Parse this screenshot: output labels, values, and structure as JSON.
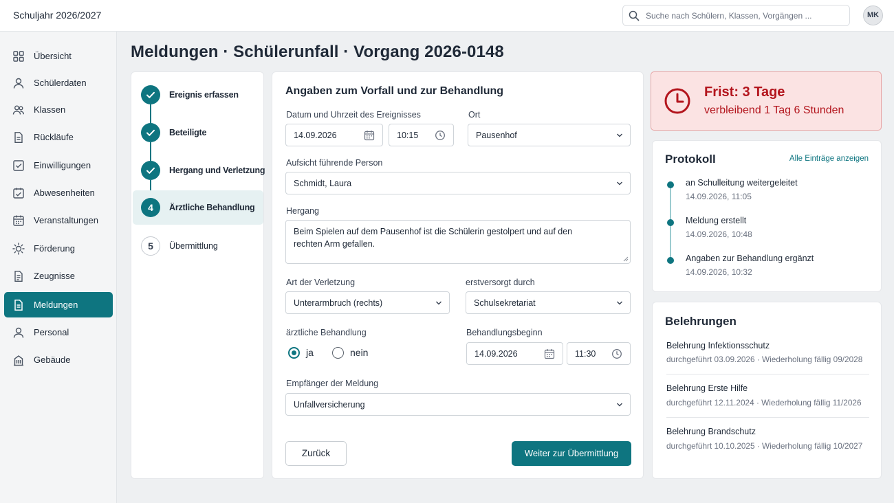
{
  "header": {
    "school_year": "Schuljahr 2026/2027",
    "search_placeholder": "Suche nach Schülern, Klassen, Vorgängen ...",
    "user_initials": "MK"
  },
  "sidebar": {
    "items": [
      {
        "label": "Übersicht",
        "icon": "grid-icon",
        "active": false
      },
      {
        "label": "Schülerdaten",
        "icon": "person-icon",
        "active": false
      },
      {
        "label": "Klassen",
        "icon": "group-icon",
        "active": false
      },
      {
        "label": "Rückläufe",
        "icon": "document-icon",
        "active": false
      },
      {
        "label": "Einwilligungen",
        "icon": "checkbox-icon",
        "active": false
      },
      {
        "label": "Abwesenheiten",
        "icon": "calendar-check-icon",
        "active": false
      },
      {
        "label": "Veranstaltungen",
        "icon": "calendar-icon",
        "active": false
      },
      {
        "label": "Förderung",
        "icon": "sun-icon",
        "active": false
      },
      {
        "label": "Zeugnisse",
        "icon": "certificate-icon",
        "active": false
      },
      {
        "label": "Meldungen",
        "icon": "report-icon",
        "active": true
      },
      {
        "label": "Personal",
        "icon": "person-icon",
        "active": false
      },
      {
        "label": "Gebäude",
        "icon": "building-icon",
        "active": false
      }
    ]
  },
  "page": {
    "title": "Meldungen · Schülerunfall · Vorgang 2026-0148"
  },
  "stepper": {
    "steps": [
      {
        "label": "Ereignis erfassen",
        "state": "done",
        "number": "1"
      },
      {
        "label": "Beteiligte",
        "state": "done",
        "number": "2"
      },
      {
        "label": "Hergang und Verletzung",
        "state": "done",
        "number": "3"
      },
      {
        "label": "Ärztliche Behandlung",
        "state": "current",
        "number": "4"
      },
      {
        "label": "Übermittlung",
        "state": "todo",
        "number": "5"
      }
    ]
  },
  "form": {
    "title": "Angaben zum Vorfall und zur Behandlung",
    "event_datetime_label": "Datum und Uhrzeit des Ereignisses",
    "event_date": "14.09.2026",
    "event_time": "10:15",
    "location_label": "Ort",
    "location": "Pausenhof",
    "supervisor_label": "Aufsicht führende Person",
    "supervisor": "Schmidt, Laura",
    "course_label": "Hergang",
    "course_text": "Beim Spielen auf dem Pausenhof ist die Schülerin gestolpert und auf den rechten Arm gefallen.",
    "injury_label": "Art der Verletzung",
    "injury": "Unterarmbruch (rechts)",
    "first_aid_label": "erstversorgt durch",
    "first_aid": "Schulsekretariat",
    "medical_label": "ärztliche Behandlung",
    "medical_yes": "ja",
    "medical_no": "nein",
    "medical_value": "ja",
    "treatment_start_label": "Behandlungsbeginn",
    "treatment_date": "14.09.2026",
    "treatment_time": "11:30",
    "recipient_label": "Empfänger der Meldung",
    "recipient": "Unfallversicherung",
    "back_label": "Zurück",
    "next_label": "Weiter zur Übermittlung"
  },
  "deadline": {
    "title": "Frist: 3 Tage",
    "remaining": "verbleibend 1 Tag 6 Stunden",
    "color": "#b3151d"
  },
  "protocol": {
    "title": "Protokoll",
    "show_all": "Alle Einträge anzeigen",
    "entries": [
      {
        "title": "an Schulleitung weitergeleitet",
        "time": "14.09.2026, 11:05"
      },
      {
        "title": "Meldung erstellt",
        "time": "14.09.2026, 10:48"
      },
      {
        "title": "Angaben zur Behandlung ergänzt",
        "time": "14.09.2026, 10:32"
      }
    ]
  },
  "instructions": {
    "title": "Belehrungen",
    "items": [
      {
        "title": "Belehrung Infektionsschutz",
        "detail": "durchgeführt 03.09.2026 · Wiederholung fällig 09/2028"
      },
      {
        "title": "Belehrung Erste Hilfe",
        "detail": "durchgeführt 12.11.2024 · Wiederholung fällig 11/2026"
      },
      {
        "title": "Belehrung Brandschutz",
        "detail": "durchgeführt 10.10.2025 · Wiederholung fällig 10/2027"
      }
    ]
  },
  "colors": {
    "accent": "#0e7580",
    "danger_bg": "#fbe3e3",
    "danger": "#b3151d"
  }
}
